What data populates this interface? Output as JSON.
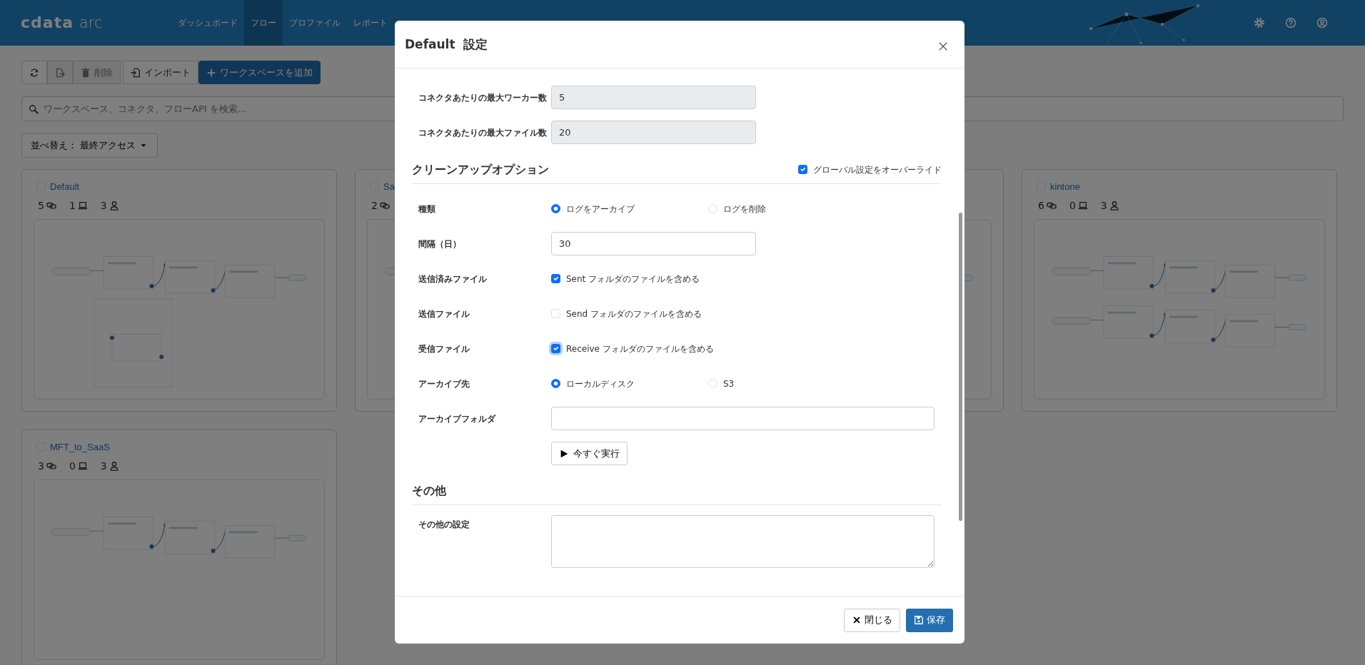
{
  "header": {
    "logo": {
      "brand": "cdata",
      "product": "arc"
    },
    "nav": [
      {
        "label": "ダッシュボード",
        "selected": false
      },
      {
        "label": "フロー",
        "selected": true
      },
      {
        "label": "プロファイル",
        "selected": false
      },
      {
        "label": "レポート",
        "selected": false
      }
    ]
  },
  "toolbar": [
    {
      "kind": "refresh",
      "disabled": false
    },
    {
      "kind": "export",
      "disabled": true
    },
    {
      "kind": "delete",
      "label": "削除",
      "disabled": true
    },
    {
      "kind": "import",
      "label": "インポート",
      "disabled": false
    },
    {
      "kind": "add",
      "label": "ワークスペースを追加",
      "disabled": false
    }
  ],
  "search": {
    "placeholder": "ワークスペース、コネクタ、フローAPI を検索..."
  },
  "sort": {
    "label": "並べ替え：",
    "value": "最終アクセス"
  },
  "workspaces": [
    {
      "kind": "workspace",
      "title": "Default",
      "checked": false,
      "connectors": "5",
      "agents": "1",
      "users": "3"
    },
    {
      "kind": "workspace",
      "title": "Sa",
      "checked": false,
      "connectors": "2"
    },
    {
      "kind": "covered"
    },
    {
      "kind": "workspace",
      "title": "kintone",
      "checked": false,
      "connectors": "6",
      "agents": "0",
      "users": "3"
    },
    {
      "kind": "workspace",
      "title": "MFT_to_SaaS",
      "checked": false,
      "connectors": "3",
      "agents": "0",
      "users": "3"
    }
  ],
  "modal": {
    "title": "Default  設定",
    "body": [
      {
        "kind": "field",
        "label": "コネクタあたりの最大ワーカー数",
        "value": "5",
        "readonly": true
      },
      {
        "kind": "field",
        "label": "コネクタあたりの最大ファイル数",
        "value": "20",
        "readonly": true
      },
      {
        "kind": "heading",
        "label": "クリーンアップオプション",
        "option": {
          "label": "グローバル設定をオーバーライド",
          "checked": true
        }
      },
      {
        "kind": "radio",
        "label": "種類",
        "options": [
          {
            "label": "ログをアーカイブ",
            "selected": true
          },
          {
            "label": "ログを削除",
            "selected": false
          }
        ]
      },
      {
        "kind": "field",
        "label": "間隔（日）",
        "value": "30",
        "readonly": false
      },
      {
        "kind": "checkbox",
        "label": "送信済みファイル",
        "text": "Sent フォルダのファイルを含める",
        "checked": true,
        "focused": false
      },
      {
        "kind": "checkbox",
        "label": "送信ファイル",
        "text": "Send フォルダのファイルを含める",
        "checked": false,
        "focused": false
      },
      {
        "kind": "checkbox",
        "label": "受信ファイル",
        "text": "Receive フォルダのファイルを含める",
        "checked": true,
        "focused": true
      },
      {
        "kind": "radio",
        "label": "アーカイブ先",
        "options": [
          {
            "label": "ローカルディスク",
            "selected": true
          },
          {
            "label": "S3",
            "selected": false
          }
        ]
      },
      {
        "kind": "wide_field",
        "label": "アーカイブフォルダ",
        "readonly": false
      },
      {
        "kind": "action",
        "label": "今すぐ実行"
      },
      {
        "kind": "heading",
        "label": "その他"
      },
      {
        "kind": "textarea",
        "label": "その他の設定"
      }
    ],
    "footer": [
      {
        "kind": "close",
        "label": "閉じる"
      },
      {
        "kind": "save",
        "label": "保存"
      }
    ]
  }
}
